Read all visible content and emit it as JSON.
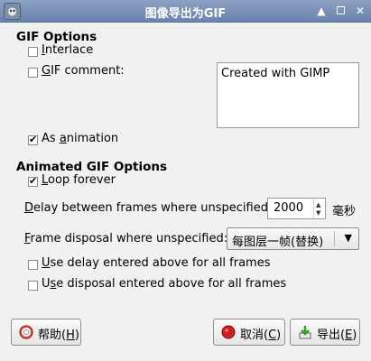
{
  "window": {
    "title": "图像导出为GIF",
    "controls": [
      "up",
      "maximize",
      "close"
    ]
  },
  "gif_options": {
    "heading": "GIF Options",
    "interlace": {
      "label_u": "I",
      "label_rest": "nterlace",
      "checked": false
    },
    "gif_comment": {
      "label_u": "G",
      "label_rest": "IF comment:",
      "checked": false
    },
    "comment_text": "Created with GIMP",
    "as_animation": {
      "label_pre": "As ",
      "label_u": "a",
      "label_rest": "nimation",
      "checked": true
    }
  },
  "animated": {
    "heading": "Animated GIF Options",
    "loop_forever": {
      "label_u": "L",
      "label_rest": "oop forever",
      "checked": true
    },
    "delay": {
      "label_u": "D",
      "label_rest": "elay between frames where unspecified:",
      "value": "2000",
      "unit": "毫秒"
    },
    "disposal": {
      "label_u": "F",
      "label_rest": "rame disposal where unspecified:",
      "selected": "每图层一帧(替换)"
    },
    "use_delay": {
      "label_u": "U",
      "label_rest": "se delay entered above for all frames",
      "checked": false
    },
    "use_disposal": {
      "label_pre": "U",
      "label_u": "s",
      "label_rest": "e disposal entered above for all frames",
      "checked": false
    }
  },
  "buttons": {
    "help": {
      "pre": "帮助(",
      "u": "H",
      "post": ")",
      "icon": "help-lifebuoy-icon"
    },
    "cancel": {
      "pre": "取消(",
      "u": "C",
      "post": ")",
      "icon": "cancel-stop-icon"
    },
    "export": {
      "pre": "导出(",
      "u": "E",
      "post": ")",
      "icon": "export-arrow-icon"
    }
  },
  "colors": {
    "titlebar": "#7a90b8",
    "cancel_icon": "#cc1f1f",
    "export_icon": "#3a9a2a"
  }
}
